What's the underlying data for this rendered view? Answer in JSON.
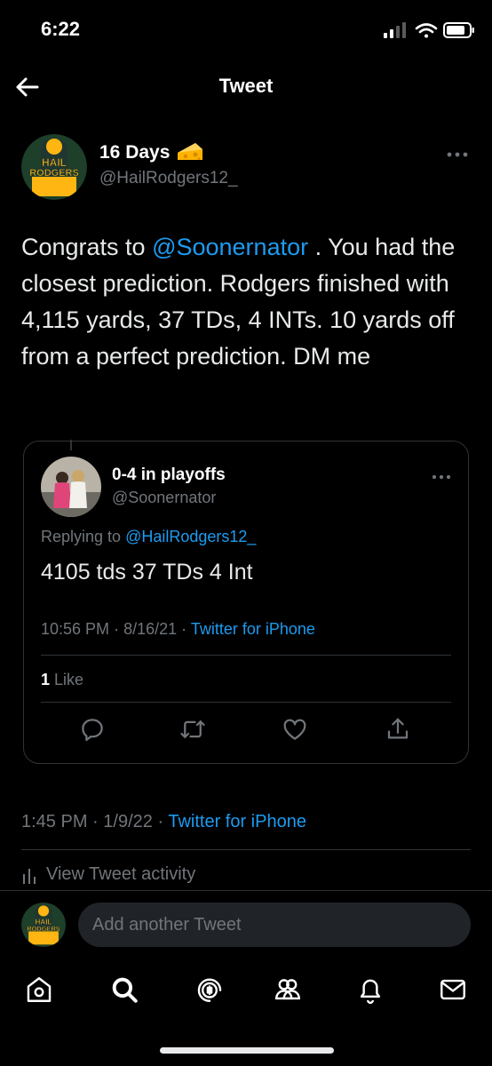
{
  "status_bar": {
    "time": "6:22"
  },
  "header": {
    "title": "Tweet"
  },
  "tweet": {
    "author_name": "16 Days",
    "author_handle": "@HailRodgers12_",
    "avatar_text": [
      "HAIL",
      "RODGERS"
    ],
    "text_before": "Congrats to ",
    "mention": "@Soonernator",
    "text_after": " . You had the closest prediction. Rodgers finished with 4,115 yards, 37 TDs, 4 INTs. 10 yards off from a perfect prediction. DM me",
    "time": "1:45 PM",
    "date": "1/9/22",
    "source": "Twitter for iPhone",
    "activity_label": "View Tweet activity"
  },
  "reply": {
    "author_name": "0-4 in playoffs",
    "author_handle": "@Soonernator",
    "replying_to_label": "Replying to",
    "replying_to_handle": "@HailRodgers12_",
    "text": "4105 tds 37 TDs 4 Int",
    "time": "10:56 PM",
    "date": "8/16/21",
    "source": "Twitter for iPhone",
    "likes_count": "1",
    "likes_label": "Like"
  },
  "composer": {
    "placeholder": "Add another Tweet"
  },
  "sep": "·",
  "colors": {
    "background": "#000000",
    "accent": "#1d9bf0",
    "muted": "#71767b",
    "divider": "#2f3336"
  },
  "icons": [
    "back-arrow-icon",
    "cheese-icon",
    "more-icon",
    "reply-icon",
    "retweet-icon",
    "like-icon",
    "share-icon",
    "bars-icon",
    "home-icon",
    "search-icon",
    "spaces-icon",
    "communities-icon",
    "bell-icon",
    "mail-icon"
  ]
}
